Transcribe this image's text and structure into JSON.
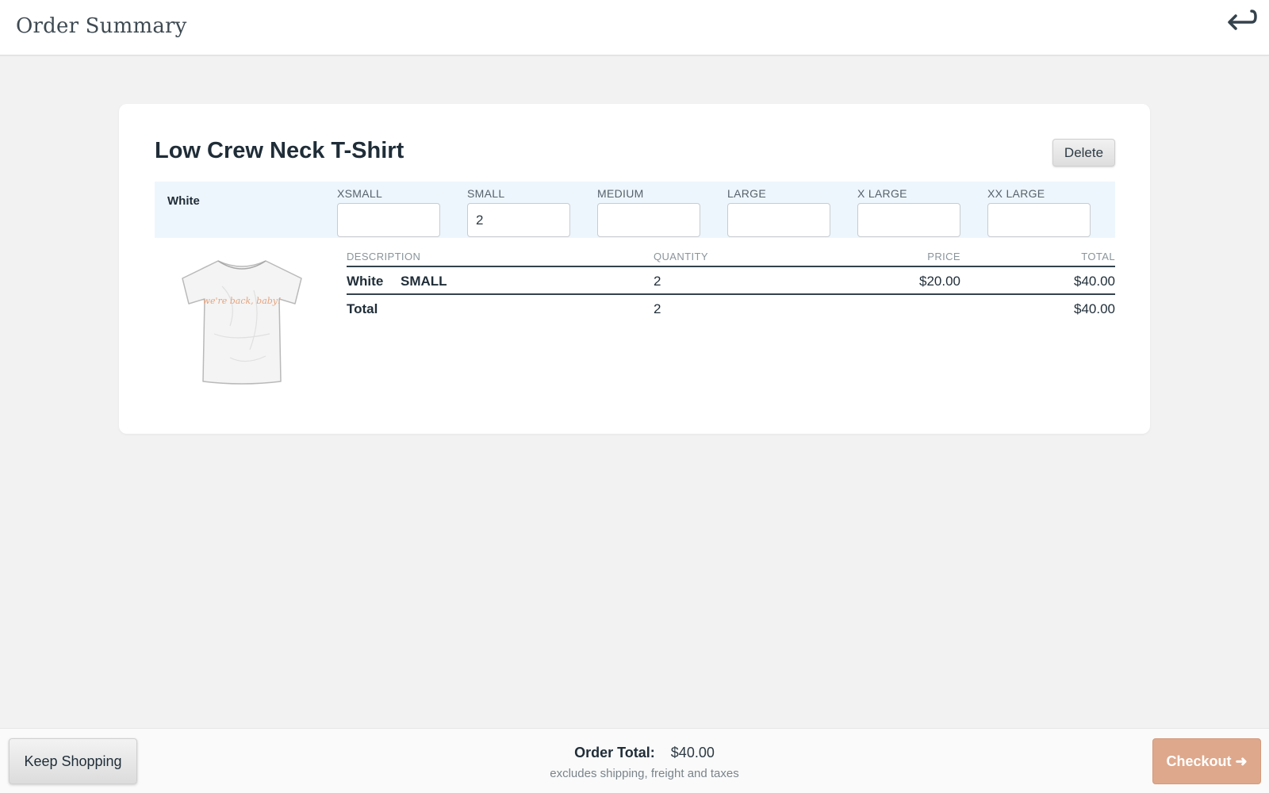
{
  "header": {
    "title": "Order Summary",
    "back_icon": "return-arrow-icon"
  },
  "product": {
    "name": "Low Crew Neck T-Shirt",
    "delete_label": "Delete",
    "color": "White",
    "sizes": [
      {
        "label": "XSMALL",
        "value": ""
      },
      {
        "label": "SMALL",
        "value": "2"
      },
      {
        "label": "MEDIUM",
        "value": ""
      },
      {
        "label": "LARGE",
        "value": ""
      },
      {
        "label": "X LARGE",
        "value": ""
      },
      {
        "label": "XX LARGE",
        "value": ""
      }
    ],
    "shirt_print_text": "we're back, baby!"
  },
  "table": {
    "headers": {
      "description": "DESCRIPTION",
      "quantity": "QUANTITY",
      "price": "PRICE",
      "total": "TOTAL"
    },
    "rows": [
      {
        "color": "White",
        "size": "SMALL",
        "quantity": "2",
        "price": "$20.00",
        "total": "$40.00"
      }
    ],
    "summary": {
      "label": "Total",
      "quantity": "2",
      "total": "$40.00"
    }
  },
  "footer": {
    "keep_shopping_label": "Keep Shopping",
    "order_total_label": "Order Total:",
    "order_total_value": "$40.00",
    "excludes_note": "excludes shipping, freight and taxes",
    "checkout_label": "Checkout ➜"
  },
  "colors": {
    "background": "#f2f2f2",
    "card": "#ffffff",
    "size_band": "#eef6fd",
    "checkout": "#dea88c",
    "text": "#1f2d38"
  }
}
